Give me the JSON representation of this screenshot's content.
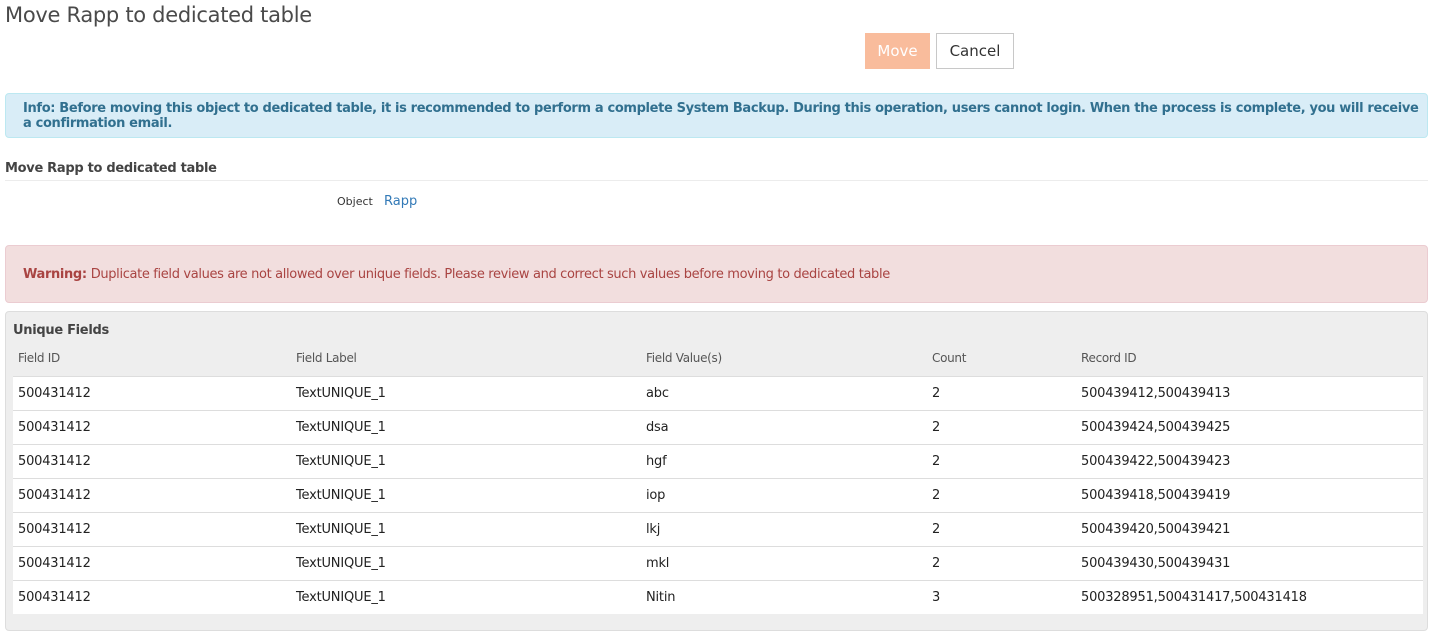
{
  "page_title": "Move Rapp to dedicated table",
  "buttons": {
    "move": "Move",
    "cancel": "Cancel"
  },
  "info": "Info: Before moving this object to dedicated table, it is recommended to perform a complete System Backup. During this operation, users cannot login. When the process is complete, you will receive a confirmation email.",
  "section": {
    "title": "Move Rapp to dedicated table",
    "object_label": "Object",
    "object_value": "Rapp"
  },
  "warning": {
    "label": "Warning:",
    "text": "Duplicate field values are not allowed over unique fields. Please review and correct such values before moving to dedicated table"
  },
  "unique_fields": {
    "title": "Unique Fields",
    "columns": [
      "Field ID",
      "Field Label",
      "Field Value(s)",
      "Count",
      "Record ID"
    ],
    "rows": [
      [
        "500431412",
        "TextUNIQUE_1",
        "abc",
        "2",
        "500439412,500439413"
      ],
      [
        "500431412",
        "TextUNIQUE_1",
        "dsa",
        "2",
        "500439424,500439425"
      ],
      [
        "500431412",
        "TextUNIQUE_1",
        "hgf",
        "2",
        "500439422,500439423"
      ],
      [
        "500431412",
        "TextUNIQUE_1",
        "iop",
        "2",
        "500439418,500439419"
      ],
      [
        "500431412",
        "TextUNIQUE_1",
        "lkj",
        "2",
        "500439420,500439421"
      ],
      [
        "500431412",
        "TextUNIQUE_1",
        "mkl",
        "2",
        "500439430,500439431"
      ],
      [
        "500431412",
        "TextUNIQUE_1",
        "Nitin",
        "3",
        "500328951,500431417,500431418"
      ]
    ]
  },
  "colors": {
    "move_button_bg": "#f9bc9c",
    "info_bg": "#d9edf7",
    "info_text": "#31708f",
    "warning_bg": "#f2dede",
    "warning_text": "#a94442",
    "link": "#337ab7"
  }
}
